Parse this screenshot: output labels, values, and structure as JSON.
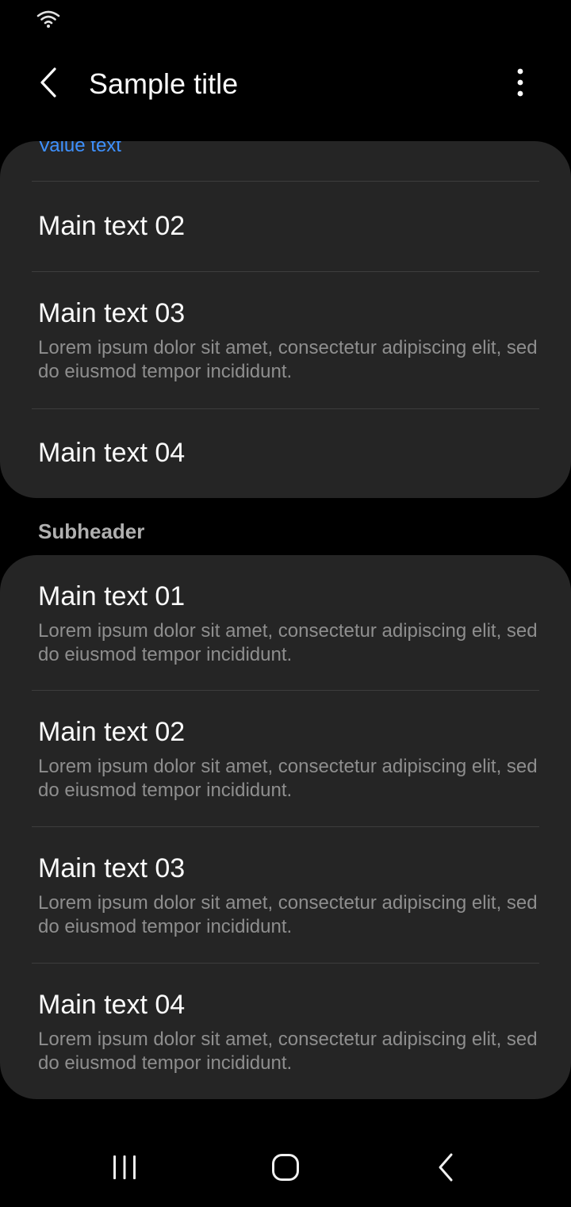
{
  "app_bar": {
    "title": "Sample title"
  },
  "icons": {
    "status": "wifi-icon",
    "back": "chevron-left-icon",
    "more": "more-vertical-icon",
    "nav_recents": "recents-icon",
    "nav_home": "home-icon",
    "nav_back": "back-icon"
  },
  "colors": {
    "background": "#000000",
    "card": "#252525",
    "accent": "#3e91ff",
    "primary_text": "#fafafa",
    "secondary_text": "#8e8e8e",
    "subheader_text": "#b0b0b0",
    "divider": "#3d3d3d"
  },
  "section1": {
    "value_text": "Value text",
    "items": [
      {
        "main": "Main text 02"
      },
      {
        "main": "Main text 03",
        "sub": "Lorem ipsum dolor sit amet, consectetur adipiscing elit, sed do eiusmod tempor incididunt."
      },
      {
        "main": "Main text 04"
      }
    ]
  },
  "section2": {
    "subheader": "Subheader",
    "items": [
      {
        "main": "Main text 01",
        "sub": "Lorem ipsum dolor sit amet, consectetur adipiscing elit, sed do eiusmod tempor incididunt."
      },
      {
        "main": "Main text 02",
        "sub": "Lorem ipsum dolor sit amet, consectetur adipiscing elit, sed do eiusmod tempor incididunt."
      },
      {
        "main": "Main text 03",
        "sub": "Lorem ipsum dolor sit amet, consectetur adipiscing elit, sed do eiusmod tempor incididunt."
      },
      {
        "main": "Main text 04",
        "sub": "Lorem ipsum dolor sit amet, consectetur adipiscing elit, sed do eiusmod tempor incididunt."
      }
    ]
  }
}
